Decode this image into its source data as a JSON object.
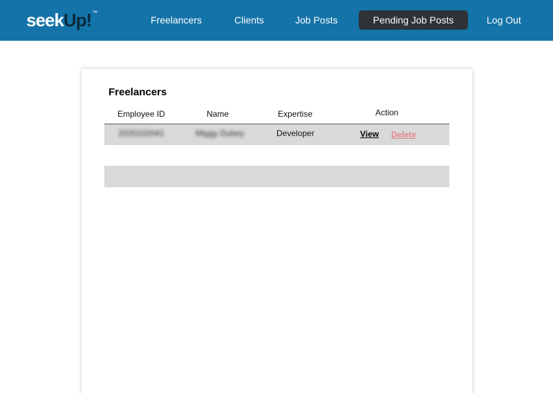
{
  "navbar": {
    "logo": {
      "part1": "seek",
      "part2": "Up!",
      "mark": "™"
    },
    "links": [
      {
        "label": "Freelancers"
      },
      {
        "label": "Clients"
      },
      {
        "label": "Job Posts"
      },
      {
        "label": "Pending Job Posts",
        "active": true
      },
      {
        "label": "Log Out"
      }
    ]
  },
  "main": {
    "title": "Freelancers",
    "table": {
      "columns": [
        "Employee ID",
        "Name",
        "Expertise",
        "Action"
      ],
      "rows": [
        {
          "employee_id": "2020102041",
          "name": "Miggy Dubey",
          "expertise": "Developer",
          "view_label": "View",
          "delete_label": "Delete"
        }
      ]
    }
  },
  "colors": {
    "navbar": "#1473a8",
    "active_nav": "#2f3237",
    "row_bg": "#d9d9d9",
    "delete": "#e0848f"
  }
}
